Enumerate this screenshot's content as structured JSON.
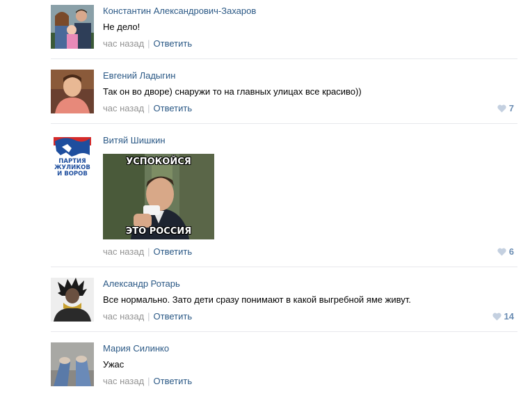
{
  "comments": [
    {
      "author": "Константин Александрович-Захаров",
      "text": "Не дело!",
      "time": "час назад",
      "reply": "Ответить",
      "likes": ""
    },
    {
      "author": "Евгений Ладыгин",
      "text": "Так он во дворе) снаружи то на главных улицах все красиво))",
      "time": "час назад",
      "reply": "Ответить",
      "likes": "7"
    },
    {
      "author": "Витяй Шишкин",
      "text": "",
      "time": "час назад",
      "reply": "Ответить",
      "likes": "6",
      "avatar_text": [
        "ПАРТИЯ",
        "ЖУЛИКОВ",
        "И ВОРОВ"
      ],
      "meme": {
        "top": "УСПОКОЙСЯ",
        "bottom": "ЭТО РОССИЯ"
      }
    },
    {
      "author": "Александр Ротарь",
      "text": "Все нормально. Зато дети сразу понимают в какой выгребной яме живут.",
      "time": "час назад",
      "reply": "Ответить",
      "likes": "14"
    },
    {
      "author": "Мария Силинко",
      "text": "Ужас",
      "time": "час назад",
      "reply": "Ответить",
      "likes": ""
    }
  ],
  "colors": {
    "link": "#2a5885",
    "meta": "#939393",
    "like": "#6b8db3",
    "divider": "#e7e8ec"
  }
}
